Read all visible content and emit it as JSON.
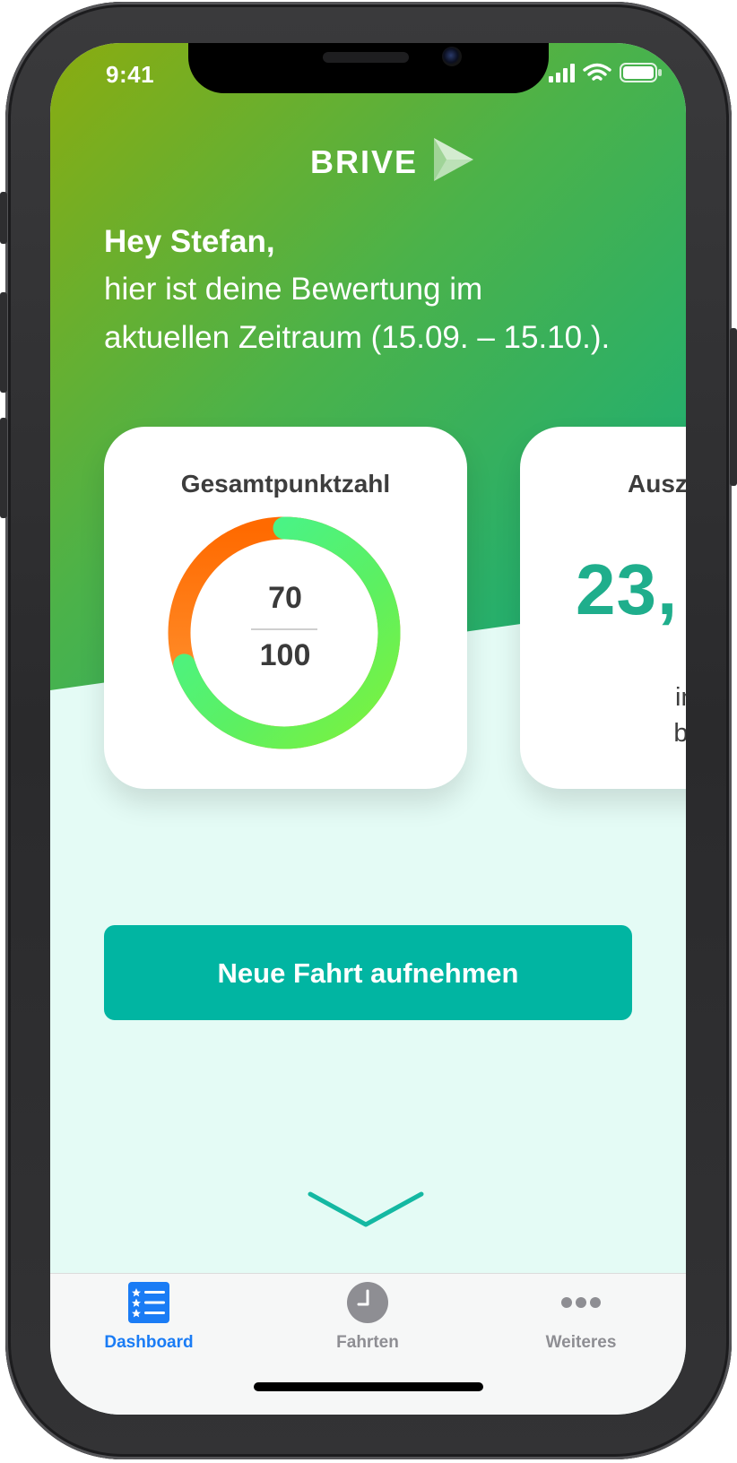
{
  "status_bar": {
    "time": "9:41"
  },
  "app": {
    "brand_name": "BRIVE",
    "brand_icon": "play-triangle-logo",
    "gradient_start": "#8aac10",
    "gradient_end": "#1ab27a",
    "accent_color": "#01b5a2"
  },
  "greeting": {
    "title": "Hey Stefan,",
    "line1": "hier ist deine Bewertung im",
    "line2": "aktuellen Zeitraum (15.09. – 15.10.)."
  },
  "cards": {
    "score": {
      "title": "Gesamtpunktzahl",
      "value": 70,
      "value_label": "70",
      "max_label": "100",
      "ring_colors": [
        "#ff6a00",
        "#64f252",
        "#3ff59a"
      ]
    },
    "payout": {
      "title": "Ausz",
      "value": "23,",
      "desc_line1": "in diese",
      "desc_line2": "bereits g"
    }
  },
  "actions": {
    "new_trip_label": "Neue Fahrt aufnehmen",
    "scroll_icon": "chevron-down-icon"
  },
  "tabbar": {
    "tabs": [
      {
        "label": "Dashboard",
        "icon": "list-star-icon",
        "active": true,
        "color": "#1a7cf5"
      },
      {
        "label": "Fahrten",
        "icon": "clock-icon",
        "active": false,
        "color": "#8e8e93"
      },
      {
        "label": "Weiteres",
        "icon": "more-dots-icon",
        "active": false,
        "color": "#8e8e93"
      }
    ]
  }
}
